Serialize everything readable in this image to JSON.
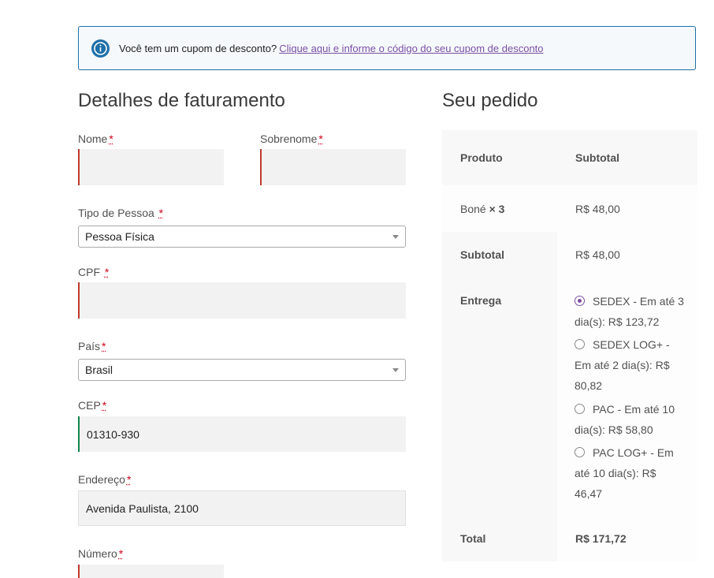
{
  "notice": {
    "text": "Você tem um cupom de desconto?",
    "link": "Clique aqui e informe o código do seu cupom de desconto"
  },
  "billing": {
    "title": "Detalhes de faturamento",
    "required_mark": "*",
    "first_name_label": "Nome",
    "last_name_label": "Sobrenome",
    "person_type_label": "Tipo de Pessoa",
    "person_type_value": "Pessoa Física",
    "cpf_label": "CPF",
    "country_label": "País",
    "country_value": "Brasil",
    "cep_label": "CEP",
    "cep_value": "01310-930",
    "address_label": "Endereço",
    "address_value": "Avenida Paulista, 2100",
    "number_label": "Número"
  },
  "order": {
    "title": "Seu pedido",
    "col_product": "Produto",
    "col_subtotal": "Subtotal",
    "item_name": "Boné",
    "item_qty": "× 3",
    "item_total": "R$ 48,00",
    "subtotal_label": "Subtotal",
    "subtotal_value": "R$ 48,00",
    "shipping_label": "Entrega",
    "shipping_options": [
      {
        "label": "SEDEX - Em até 3 dia(s): R$ 123,72",
        "selected": true
      },
      {
        "label": "SEDEX LOG+ - Em até 2 dia(s): R$ 80,82",
        "selected": false
      },
      {
        "label": "PAC - Em até 10 dia(s): R$ 58,80",
        "selected": false
      },
      {
        "label": "PAC LOG+ - Em até 10 dia(s): R$ 46,47",
        "selected": false
      }
    ],
    "total_label": "Total",
    "total_value": "R$ 171,72"
  },
  "colors": {
    "info": "#1e6fa8",
    "link": "#7a4fa3",
    "invalid": "#c0392b",
    "valid": "#0f834d",
    "required": "#d0021b"
  }
}
